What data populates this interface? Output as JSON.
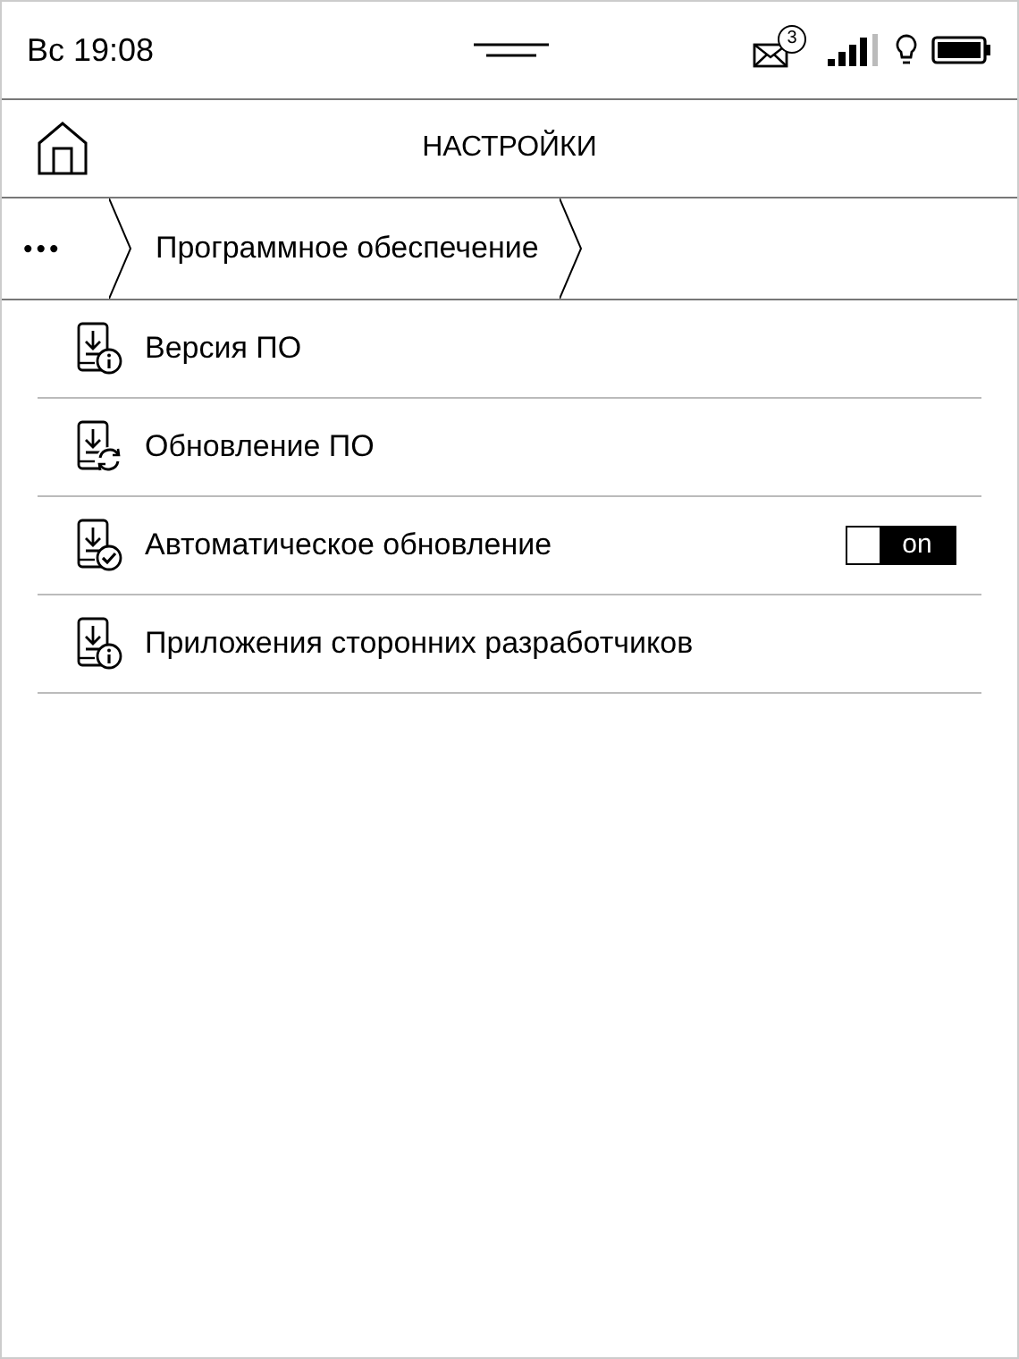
{
  "status_bar": {
    "time": "Вс 19:08",
    "mail_count": "3"
  },
  "header": {
    "title": "НАСТРОЙКИ"
  },
  "breadcrumb": {
    "more": "•••",
    "items": [
      "Программное обеспечение"
    ]
  },
  "items": [
    {
      "label": "Версия ПО",
      "kind": "info"
    },
    {
      "label": "Обновление ПО",
      "kind": "update"
    },
    {
      "label": "Автоматическое обновление",
      "kind": "toggle",
      "on": true,
      "toggle_text": "on"
    },
    {
      "label": "Приложения сторонних разработчиков",
      "kind": "info"
    }
  ]
}
